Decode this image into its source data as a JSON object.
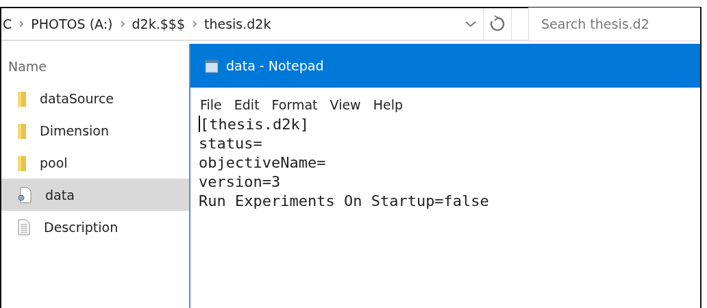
{
  "address_bar": {
    "breadcrumbs": [
      "C",
      "PHOTOS (A:)",
      "d2k.$$$",
      "thesis.d2k"
    ],
    "search": {
      "placeholder": "Search thesis.d2"
    }
  },
  "file_list": {
    "column_header": "Name",
    "items": [
      {
        "name": "dataSource",
        "kind": "folder",
        "selected": false
      },
      {
        "name": "Dimension",
        "kind": "folder",
        "selected": false
      },
      {
        "name": "pool",
        "kind": "folder",
        "selected": false
      },
      {
        "name": "data",
        "kind": "config",
        "selected": true
      },
      {
        "name": "Description",
        "kind": "text",
        "selected": false
      }
    ]
  },
  "notepad": {
    "title": "data - Notepad",
    "menu": [
      "File",
      "Edit",
      "Format",
      "View",
      "Help"
    ],
    "lines": [
      "[thesis.d2k]",
      "status=",
      "objectiveName=",
      "version=3",
      "Run Experiments On Startup=false"
    ]
  }
}
